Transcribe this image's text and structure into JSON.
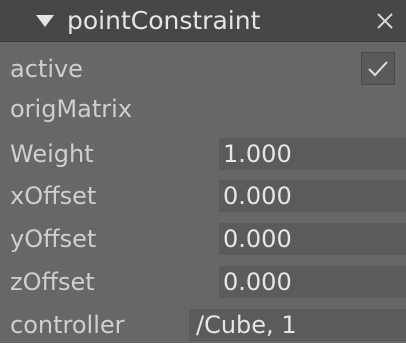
{
  "header": {
    "title": "pointConstraint"
  },
  "icons": {
    "collapse": "triangle-down-icon",
    "close": "close-x-icon",
    "check": "checkmark-icon"
  },
  "attributes": {
    "active": {
      "label": "active",
      "checked": true
    },
    "origMatrix": {
      "label": "origMatrix"
    },
    "weight": {
      "label": "Weight",
      "value": "1.000"
    },
    "xOffset": {
      "label": "xOffset",
      "value": "0.000"
    },
    "yOffset": {
      "label": "yOffset",
      "value": "0.000"
    },
    "zOffset": {
      "label": "zOffset",
      "value": "0.000"
    },
    "controller": {
      "label": "controller",
      "value": "/Cube, 1"
    }
  },
  "colors": {
    "panel_bg": "#676767",
    "header_bg": "#474747",
    "field_bg": "#5b5b5b",
    "label_text": "#cfcfcf",
    "value_text": "#e6e6e6"
  }
}
